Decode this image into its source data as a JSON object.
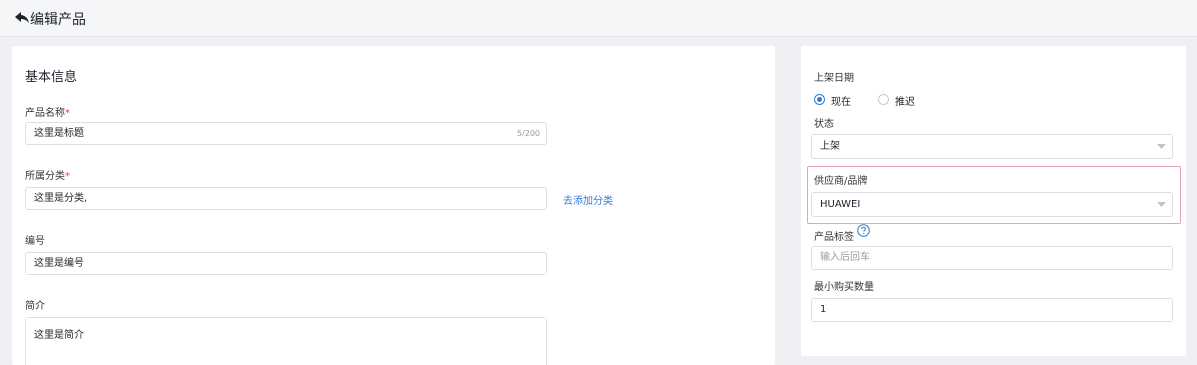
{
  "header": {
    "title": "编辑产品"
  },
  "basic": {
    "section_title": "基本信息",
    "name_label": "产品名称",
    "name_value": "这里是标题",
    "name_counter": "5/200",
    "category_label": "所属分类",
    "category_value": "这里是分类,",
    "add_category_link": "去添加分类",
    "code_label": "编号",
    "code_value": "这里是编号",
    "intro_label": "简介",
    "intro_value": "这里是简介",
    "required_mark": "*"
  },
  "side": {
    "shelf_date_label": "上架日期",
    "radio_now": "现在",
    "radio_later": "推迟",
    "radio_selected": "现在",
    "status_label": "状态",
    "status_value": "上架",
    "supplier_label": "供应商/品牌",
    "supplier_value": "HUAWEI",
    "tags_label": "产品标签",
    "tags_placeholder": "输入后回车",
    "min_qty_label": "最小购买数量",
    "min_qty_value": "1"
  },
  "colors": {
    "accent": "#2f7bd9",
    "required": "#e2434b",
    "highlight": "#e8a3b6"
  }
}
